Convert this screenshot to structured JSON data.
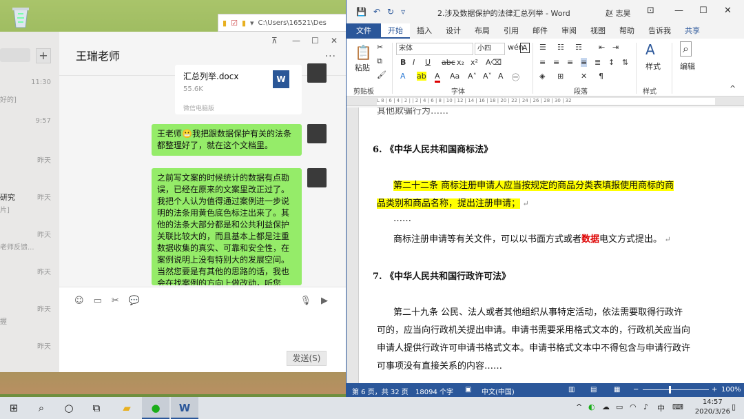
{
  "explorer": {
    "path": "C:\\Users\\16521\\Des"
  },
  "wechat": {
    "chat_title": "王瑞老师",
    "more_label": "···",
    "window_buttons": {
      "pin": "⊼",
      "minimize": "—",
      "maximize": "☐",
      "close": "✕"
    },
    "list_items": [
      {
        "time": "11:30",
        "snippet": "好的]"
      },
      {
        "time": "9:57",
        "snippet": ""
      },
      {
        "time": "昨天",
        "snippet": ""
      },
      {
        "time": "昨天",
        "name": "研究",
        "snippet": "片]"
      },
      {
        "time": "昨天",
        "snippet": "老师反馈..."
      },
      {
        "time": "昨天",
        "snippet": ""
      },
      {
        "time": "昨天",
        "snippet": "握"
      },
      {
        "time": "昨天",
        "snippet": ""
      }
    ],
    "file_card": {
      "name": "汇总列举.docx",
      "size": "55.6K",
      "source": "微信电脑版",
      "icon": "W"
    },
    "messages": [
      {
        "text": "王老师😬我把跟数据保护有关的法条都整理好了，就在这个文档里。"
      },
      {
        "text": "之前写文案的时候统计的数据有点勘误，已经在原来的文案里改正过了。我把个人认为值得通过案例进一步说明的法条用黄色底色标注出来了。其他的法条大部分都是和公共利益保护关联比较大的，而且基本上都是注重数据收集的真实、可靠和安全性，在案例说明上没有特别大的发展空间。当然您要是有其他的思路的话，我也会在找案例的方向上做改动，听您的。"
      }
    ],
    "send_label": "发送(S)"
  },
  "word": {
    "title": "2.涉及数据保护的法律汇总列举 - Word",
    "user": "赵 志昊",
    "tabs": [
      "文件",
      "开始",
      "插入",
      "设计",
      "布局",
      "引用",
      "邮件",
      "审阅",
      "视图",
      "帮助",
      "告诉我",
      "共享"
    ],
    "ribbon": {
      "font_name": "宋体",
      "font_size": "小四",
      "groups": [
        "剪贴板",
        "字体",
        "段落",
        "样式",
        "编辑"
      ],
      "paste_label": "粘贴",
      "style_label": "样式",
      "edit_label": "编辑"
    },
    "ruler": "L  8 | 6 | 4 | 2 |   | 2 | 4 | 6 | 8 | 10 | 12 | 14 | 16 | 18 | 20 | 22 | 24 | 26 | 28 | 30 | 32",
    "document": {
      "top_partial": "其他欺骗行为……",
      "sec6_heading": "6.  《中华人民共和国商标法》",
      "sec6_p1a": "第二十二条  商标注册申请人应当按规定的商品分类表填报使用商标的商",
      "sec6_p1b": "品类别和商品名称，提出注册申请；",
      "ellipsis": "……",
      "sec6_p2_pre": "商标注册申请等有关文件，可以以书面方式或者",
      "sec6_p2_red": "数据",
      "sec6_p2_post": "电文方式提出。",
      "sec7_heading": "7.  《中华人民共和国行政许可法》",
      "sec7_l1": "第二十九条  公民、法人或者其他组织从事特定活动，依法需要取得行政许",
      "sec7_l2": "可的，应当向行政机关提出申请。申请书需要采用格式文本的，行政机关应当向",
      "sec7_l3": "申请人提供行政许可申请书格式文本。申请书格式文本中不得包含与申请行政许",
      "sec7_l4": "可事项没有直接关系的内容……"
    },
    "status": {
      "page": "第 6 页，共 32 页",
      "words": "18094 个字",
      "lang": "中文(中国)",
      "zoom": "100%"
    }
  },
  "taskbar": {
    "time": "14:57",
    "date": "2020/3/26",
    "ime": "中"
  }
}
